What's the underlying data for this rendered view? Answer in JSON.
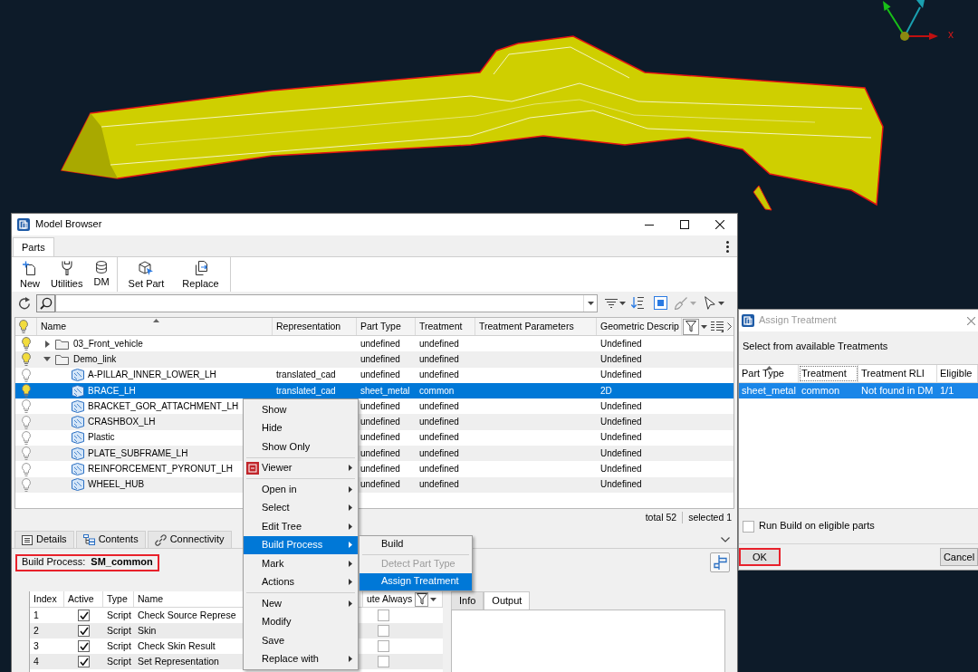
{
  "viewport": {
    "axis_label": "x"
  },
  "model_browser": {
    "title": "Model Browser",
    "tabs": [
      {
        "label": "Parts",
        "selected": true
      }
    ],
    "toolbar_groups": [
      {
        "buttons": [
          "New",
          "Utilities",
          "DM"
        ]
      },
      {
        "buttons": [
          "Set Part",
          "Replace"
        ]
      }
    ],
    "columns": [
      "Name",
      "Representation",
      "Part Type",
      "Treatment",
      "Treatment Parameters",
      "Geometric Descrip"
    ],
    "tree": [
      {
        "name": "03_Front_vehicle",
        "kind": "folder",
        "visible": true,
        "expanded": false,
        "selected": false,
        "part_type": "undefined",
        "treatment": "undefined",
        "geometric_description": "Undefined"
      },
      {
        "name": "Demo_link",
        "kind": "folder",
        "visible": true,
        "expanded": true,
        "selected": false,
        "part_type": "undefined",
        "treatment": "undefined",
        "geometric_description": "Undefined",
        "children": [
          {
            "name": "A-PILLAR_INNER_LOWER_LH",
            "kind": "part",
            "visible": false,
            "selected": false,
            "representation": "translated_cad",
            "part_type": "undefined",
            "treatment": "undefined",
            "geometric_description": "Undefined"
          },
          {
            "name": "BRACE_LH",
            "kind": "part",
            "visible": true,
            "selected": true,
            "representation": "translated_cad",
            "part_type": "sheet_metal",
            "treatment": "common",
            "geometric_description": "2D"
          },
          {
            "name": "BRACKET_GOR_ATTACHMENT_LH",
            "kind": "part",
            "visible": false,
            "selected": false,
            "part_type": "undefined",
            "treatment": "undefined",
            "geometric_description": "Undefined"
          },
          {
            "name": "CRASHBOX_LH",
            "kind": "part",
            "visible": false,
            "selected": false,
            "part_type": "undefined",
            "treatment": "undefined",
            "geometric_description": "Undefined"
          },
          {
            "name": "Plastic",
            "kind": "part",
            "visible": false,
            "selected": false,
            "part_type": "undefined",
            "treatment": "undefined",
            "geometric_description": "Undefined"
          },
          {
            "name": "PLATE_SUBFRAME_LH",
            "kind": "part",
            "visible": false,
            "selected": false,
            "part_type": "undefined",
            "treatment": "undefined",
            "geometric_description": "Undefined"
          },
          {
            "name": "REINFORCEMENT_PYRONUT_LH",
            "kind": "part",
            "visible": false,
            "selected": false,
            "part_type": "undefined",
            "treatment": "undefined",
            "geometric_description": "Undefined"
          },
          {
            "name": "WHEEL_HUB",
            "kind": "part",
            "visible": false,
            "selected": false,
            "part_type": "undefined",
            "treatment": "undefined",
            "geometric_description": "Undefined"
          }
        ]
      }
    ],
    "status": [
      "total 52",
      "selected 1"
    ],
    "detail_tabs": [
      {
        "label": "Details",
        "selected": false
      },
      {
        "label": "Contents",
        "selected": false
      },
      {
        "label": "Connectivity",
        "selected": false
      }
    ],
    "build_process": {
      "label": "Build Process:",
      "value": "SM_common",
      "highlighted": true
    },
    "steps_table": {
      "columns": [
        "Index",
        "Active",
        "Type",
        "Name",
        "ute Always"
      ],
      "rows": [
        {
          "index": "1",
          "active": true,
          "type": "Script",
          "name": "Check Source Represe",
          "execute_always": false
        },
        {
          "index": "2",
          "active": true,
          "type": "Script",
          "name": "Skin",
          "execute_always": false
        },
        {
          "index": "3",
          "active": true,
          "type": "Script",
          "name": "Check Skin Result",
          "execute_always": false
        },
        {
          "index": "4",
          "active": true,
          "type": "Script",
          "name": "Set Representation",
          "execute_always": false
        }
      ]
    },
    "output_tabs": [
      {
        "label": "Info",
        "selected": false
      },
      {
        "label": "Output",
        "selected": true
      }
    ]
  },
  "context_menu": {
    "groups": [
      {
        "items": [
          {
            "label": "Show",
            "kind": "plain",
            "submenu": false,
            "selected": false
          },
          {
            "label": "Hide",
            "kind": "plain",
            "submenu": false,
            "selected": false
          },
          {
            "label": "Show Only",
            "kind": "plain",
            "submenu": false,
            "selected": false
          }
        ]
      },
      {
        "items": [
          {
            "label": "Viewer",
            "kind": "icon",
            "submenu": true,
            "selected": false
          }
        ]
      },
      {
        "items": [
          {
            "label": "Open in",
            "kind": "plain",
            "submenu": true,
            "selected": false
          },
          {
            "label": "Select",
            "kind": "plain",
            "submenu": true,
            "selected": false
          },
          {
            "label": "Edit Tree",
            "kind": "plain",
            "submenu": true,
            "selected": false
          },
          {
            "label": "Build Process",
            "kind": "plain",
            "submenu": true,
            "selected": true
          },
          {
            "label": "Mark",
            "kind": "plain",
            "submenu": true,
            "selected": false
          },
          {
            "label": "Actions",
            "kind": "plain",
            "submenu": true,
            "selected": false
          }
        ]
      },
      {
        "items": [
          {
            "label": "New",
            "kind": "plain",
            "submenu": true,
            "selected": false
          },
          {
            "label": "Modify",
            "kind": "plain",
            "submenu": false,
            "selected": false
          },
          {
            "label": "Save",
            "kind": "plain",
            "submenu": false,
            "selected": false
          },
          {
            "label": "Replace with",
            "kind": "plain",
            "submenu": true,
            "selected": false
          }
        ]
      }
    ]
  },
  "submenu": {
    "groups": [
      {
        "items": [
          {
            "label": "Build",
            "disabled": false,
            "selected": false
          }
        ]
      },
      {
        "items": [
          {
            "label": "Detect Part Type",
            "disabled": true,
            "selected": false
          },
          {
            "label": "Assign Treatment",
            "disabled": false,
            "selected": true
          }
        ]
      }
    ]
  },
  "assign_treatment_dialog": {
    "title": "Assign Treatment",
    "active": false,
    "prompt": "Select from available Treatments",
    "columns": [
      "Part Type",
      "Treatment",
      "Treatment RLI",
      "Eligible"
    ],
    "rows": [
      {
        "cells": [
          "sheet_metal",
          "common",
          "Not found in DM",
          "1/1"
        ],
        "selected": true
      }
    ],
    "run_build": {
      "label": "Run Build on eligible parts",
      "checked": false
    },
    "buttons": [
      {
        "label": "OK",
        "highlighted": true
      },
      {
        "label": "Cancel",
        "highlighted": false
      }
    ]
  }
}
